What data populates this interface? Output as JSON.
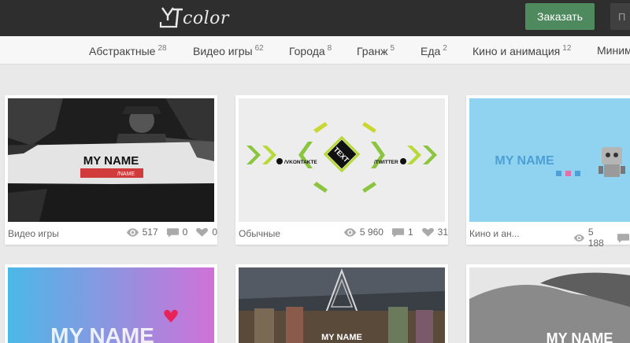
{
  "header": {
    "logo_text": "color",
    "order_label": "Заказать",
    "search_placeholder": "П"
  },
  "categories": [
    {
      "label": "Абстрактные",
      "count": "28"
    },
    {
      "label": "Видео игры",
      "count": "62"
    },
    {
      "label": "Города",
      "count": "8"
    },
    {
      "label": "Гранж",
      "count": "5"
    },
    {
      "label": "Еда",
      "count": "2"
    },
    {
      "label": "Кино и анимация",
      "count": "12"
    },
    {
      "label": "Миним",
      "count": ""
    }
  ],
  "cards": [
    {
      "caption": "Видео игры",
      "views": "517",
      "comments": "0",
      "likes": "0",
      "thumb_text": "MY NAME",
      "thumb_subtext": "/NAME"
    },
    {
      "caption": "Обычные",
      "views": "5 960",
      "comments": "1",
      "likes": "31",
      "thumb_text": "TEXT",
      "thumb_left": "/VKONTAKTE",
      "thumb_right": "/TWITTER"
    },
    {
      "caption": "Кино и ан...",
      "views": "5 188",
      "comments": "",
      "likes": "",
      "thumb_text": "MY NAME"
    }
  ],
  "row2_cards": [
    {
      "thumb_text": "MY NAME"
    },
    {
      "thumb_text": "MY NAME"
    },
    {
      "thumb_text": "MY NAME"
    }
  ],
  "colors": {
    "topbar": "#2e2e2e",
    "order_button": "#4f8a5f",
    "accent_green": "#8bc53f",
    "sky_blue": "#8fd3f0"
  }
}
